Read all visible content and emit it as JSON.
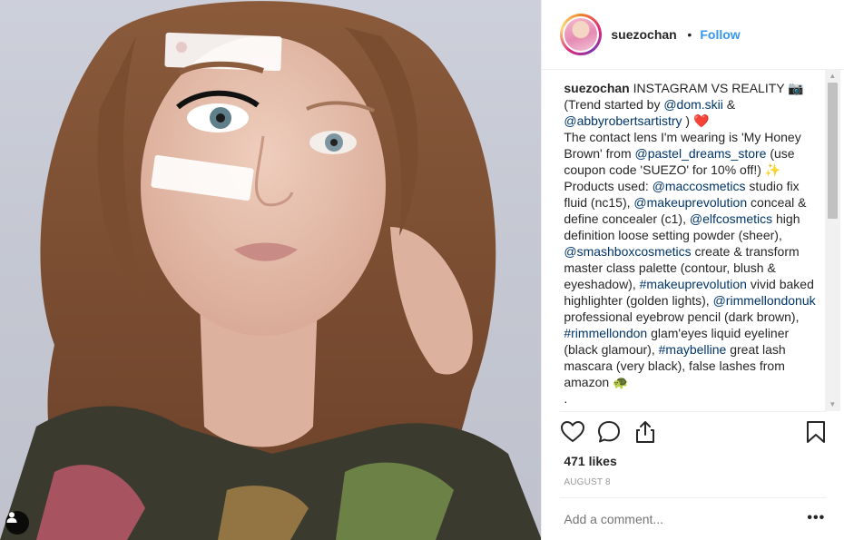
{
  "post": {
    "username": "suezochan",
    "follow_label": "Follow",
    "separator": "•",
    "caption": {
      "author": "suezochan",
      "segments": [
        {
          "t": " INSTAGRAM VS REALITY 📷",
          "m": false
        },
        {
          "br": true
        },
        {
          "t": "(Trend started by ",
          "m": false
        },
        {
          "t": "@dom.skii",
          "m": true
        },
        {
          "t": " &",
          "m": false
        },
        {
          "br": true
        },
        {
          "t": "@abbyrobertsartistry",
          "m": true
        },
        {
          "t": " ) ❤️",
          "m": false
        },
        {
          "br": true
        },
        {
          "t": "The contact lens I'm wearing is 'My Honey Brown' from ",
          "m": false
        },
        {
          "t": "@pastel_dreams_store",
          "m": true
        },
        {
          "t": " (use coupon code 'SUEZO' for 10% off!) ✨",
          "m": false
        },
        {
          "br": true
        },
        {
          "t": "Products used: ",
          "m": false
        },
        {
          "t": "@maccosmetics",
          "m": true
        },
        {
          "t": " studio fix fluid (nc15), ",
          "m": false
        },
        {
          "t": "@makeuprevolution",
          "m": true
        },
        {
          "t": " conceal & define concealer (c1), ",
          "m": false
        },
        {
          "t": "@elfcosmetics",
          "m": true
        },
        {
          "t": " high definition loose setting powder (sheer), ",
          "m": false
        },
        {
          "t": "@smashboxcosmetics",
          "m": true
        },
        {
          "t": " create & transform master class palette (contour, blush & eyeshadow), ",
          "m": false
        },
        {
          "t": "#makeuprevolution",
          "m": true
        },
        {
          "t": " vivid baked highlighter (golden lights), ",
          "m": false
        },
        {
          "t": "@rimmellondonuk",
          "m": true
        },
        {
          "t": " professional eyebrow pencil (dark brown), ",
          "m": false
        },
        {
          "t": "#rimmellondon",
          "m": true
        },
        {
          "t": " glam'eyes liquid eyeliner (black glamour), ",
          "m": false
        },
        {
          "t": "#maybelline",
          "m": true
        },
        {
          "t": " great lash mascara (very black), false lashes from amazon 🐢",
          "m": false
        },
        {
          "br": true
        },
        {
          "t": ".",
          "m": false
        }
      ]
    },
    "likes": "471 likes",
    "date": "AUGUST 8",
    "comment_placeholder": "Add a comment...",
    "more_label": "•••",
    "photo_sticker_username": "suezochan",
    "icons": [
      "heart-icon",
      "comment-icon",
      "share-icon",
      "bookmark-icon",
      "user-tag-icon"
    ],
    "colors": {
      "follow": "#3897f0",
      "mention": "#003569",
      "text": "#262626",
      "muted": "#999999"
    }
  }
}
